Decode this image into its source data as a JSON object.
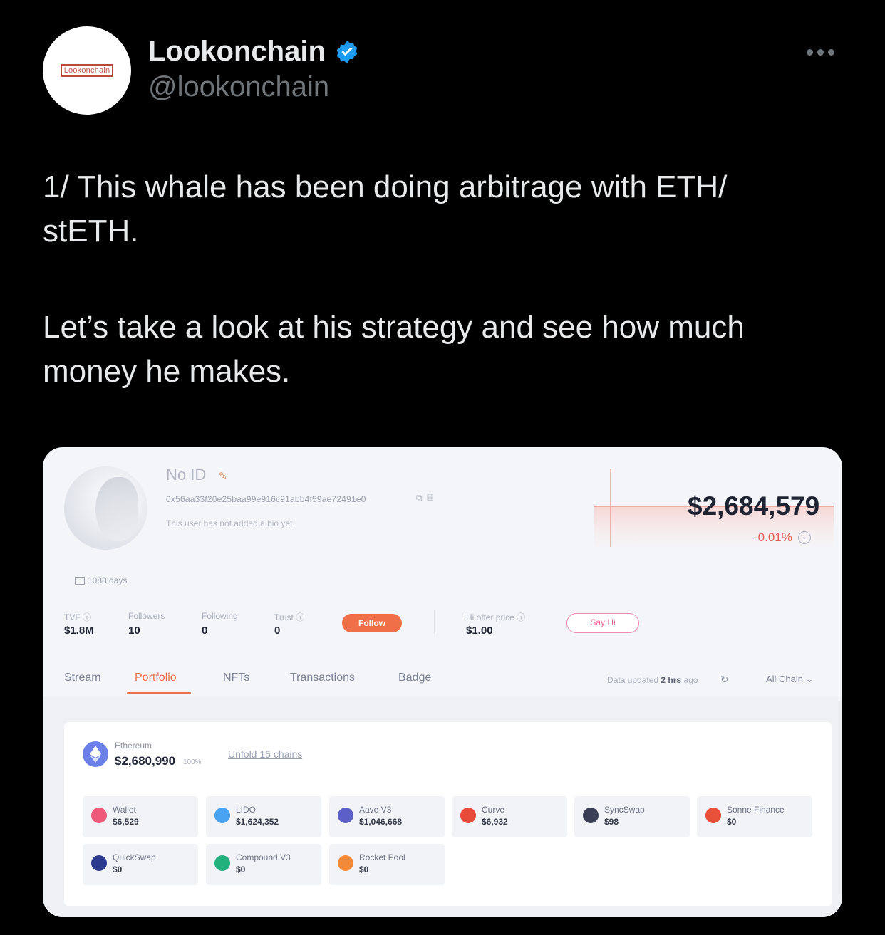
{
  "tweet": {
    "avatar_logo_text": "Lookonchain",
    "display_name": "Lookonchain",
    "handle": "@lookonchain",
    "text_line1": "1/ This whale has been doing arbitrage with ETH/",
    "text_line2": "stETH.",
    "text_line3": "Let’s take a look at his strategy and see how much",
    "text_line4": "money he makes."
  },
  "profile": {
    "name": "No ID",
    "address": "0x56aa33f20e25baa99e916c91abb4f59ae72491e0",
    "bio": "This user has not added a bio yet",
    "days": "1088 days",
    "balance": "$2,684,579",
    "change": "-0.01%",
    "stats": {
      "tvf_label": "TVF",
      "tvf_value": "$1.8M",
      "followers_label": "Followers",
      "followers_value": "10",
      "following_label": "Following",
      "following_value": "0",
      "trust_label": "Trust",
      "trust_value": "0",
      "follow_button": "Follow",
      "hi_offer_label": "Hi offer price",
      "hi_offer_value": "$1.00",
      "say_hi_button": "Say Hi"
    }
  },
  "tabs": [
    "Stream",
    "Portfolio",
    "NFTs",
    "Transactions",
    "Badge"
  ],
  "active_tab": "Portfolio",
  "data_updated_prefix": "Data updated",
  "data_updated_time": "2 hrs",
  "data_updated_suffix": "ago",
  "chain_filter": "All Chain",
  "portfolio": {
    "chain_name": "Ethereum",
    "chain_value": "$2,680,990",
    "chain_pct": "100%",
    "unfold_link": "Unfold 15 chains",
    "protocols": [
      {
        "name": "Wallet",
        "value": "$6,529",
        "icon": "wallet-icon",
        "color": "#ef5a7a"
      },
      {
        "name": "LIDO",
        "value": "$1,624,352",
        "icon": "lido-icon",
        "color": "#4aa3f0"
      },
      {
        "name": "Aave V3",
        "value": "$1,046,668",
        "icon": "aave-icon",
        "color": "#5b5fc7"
      },
      {
        "name": "Curve",
        "value": "$6,932",
        "icon": "curve-icon",
        "color": "#e84b3a"
      },
      {
        "name": "SyncSwap",
        "value": "$98",
        "icon": "syncswap-icon",
        "color": "#3a3f55"
      },
      {
        "name": "Sonne Finance",
        "value": "$0",
        "icon": "sonne-icon",
        "color": "#e8503a"
      },
      {
        "name": "QuickSwap",
        "value": "$0",
        "icon": "quickswap-icon",
        "color": "#2b3a8c"
      },
      {
        "name": "Compound V3",
        "value": "$0",
        "icon": "compound-icon",
        "color": "#22b07d"
      },
      {
        "name": "Rocket Pool",
        "value": "$0",
        "icon": "rocketpool-icon",
        "color": "#f08a3a"
      }
    ]
  }
}
